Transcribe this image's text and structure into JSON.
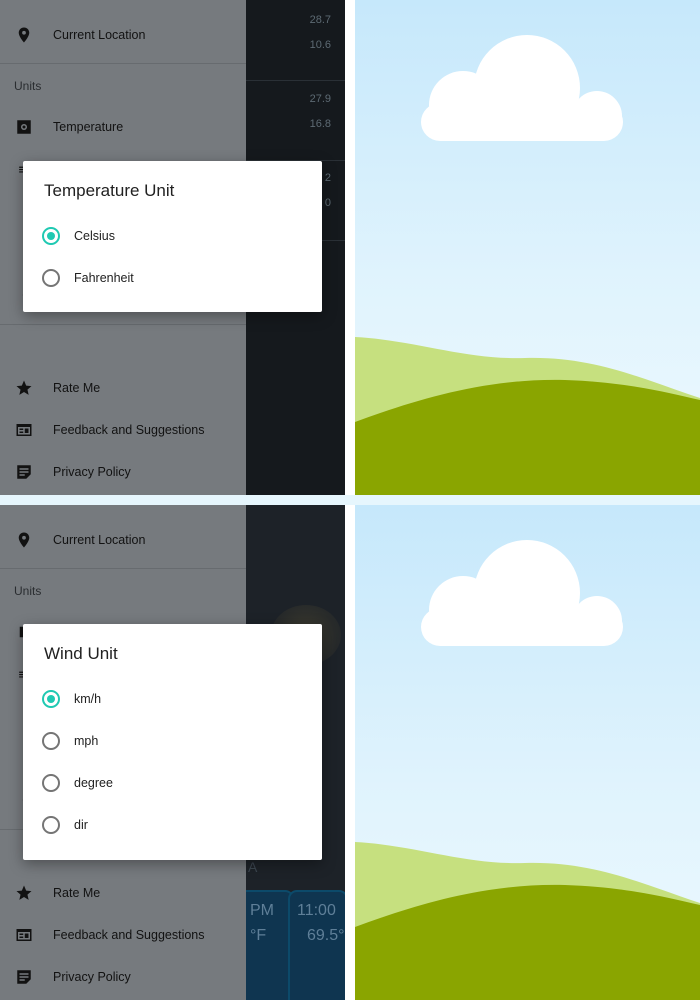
{
  "colors": {
    "accent": "#1fc9b2",
    "scrim_drawer": "#767a7e",
    "content_dark": "#15191d",
    "sky_top": "#c6e8fb",
    "hill_light": "#c6e07f",
    "hill_dark": "#8aa500",
    "cloud": "#ffffff"
  },
  "top_screen": {
    "drawer": {
      "current_location": "Current Location",
      "units_header": "Units",
      "temperature_item": "Temperature",
      "rate_me": "Rate Me",
      "feedback": "Feedback and Suggestions",
      "privacy": "Privacy Policy"
    },
    "background_values": [
      "28.7",
      "10.6",
      "27.9",
      "16.8",
      "2",
      "0"
    ],
    "dialog": {
      "title": "Temperature Unit",
      "options": [
        {
          "label": "Celsius",
          "selected": true
        },
        {
          "label": "Fahrenheit",
          "selected": false
        }
      ]
    }
  },
  "bottom_screen": {
    "drawer": {
      "current_location": "Current Location",
      "units_header": "Units",
      "rate_me": "Rate Me",
      "feedback": "Feedback and Suggestions",
      "privacy": "Privacy Policy"
    },
    "background_text": {
      "peek_a": "PM",
      "peek_b": "°F",
      "time": "11:00",
      "temp": "69.5°",
      "peek_c": "A"
    },
    "dialog": {
      "title": "Wind Unit",
      "options": [
        {
          "label": "km/h",
          "selected": true
        },
        {
          "label": "mph",
          "selected": false
        },
        {
          "label": "degree",
          "selected": false
        },
        {
          "label": "dir",
          "selected": false
        }
      ]
    }
  },
  "icons": {
    "location": "location-pin-icon",
    "temperature": "thermometer-icon",
    "rate": "star-icon",
    "feedback": "feedback-icon",
    "privacy": "document-icon"
  }
}
